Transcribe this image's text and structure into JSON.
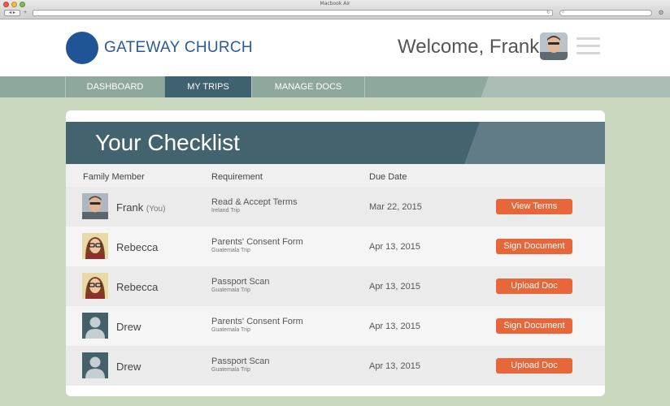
{
  "browser": {
    "window_title": "Macbook Air",
    "nav_label": "◂ ▸",
    "add_label": "+",
    "reload_label": "↻",
    "search_label": "⌕",
    "gear_label": "⚙"
  },
  "header": {
    "logo_text": "GATEWAY CHURCH",
    "welcome": "Welcome, Frank!",
    "logo_color": "#1f5597"
  },
  "nav": {
    "tabs": [
      {
        "label": "DASHBOARD",
        "active": false
      },
      {
        "label": "MY TRIPS",
        "active": true
      },
      {
        "label": "MANAGE DOCS",
        "active": false
      }
    ]
  },
  "checklist": {
    "title": "Your Checklist",
    "columns": [
      "Family Member",
      "Requirement",
      "Due Date"
    ],
    "rows": [
      {
        "member": "Frank",
        "member_note": "(You)",
        "avatar": "frank-photo",
        "requirement": "Read & Accept Terms",
        "trip": "Ireland Trip",
        "due": "Mar 22, 2015",
        "action": "View Terms"
      },
      {
        "member": "Rebecca",
        "member_note": "",
        "avatar": "rebecca-photo",
        "requirement": "Parents' Consent Form",
        "trip": "Guatemala Trip",
        "due": "Apr 13, 2015",
        "action": "Sign Document"
      },
      {
        "member": "Rebecca",
        "member_note": "",
        "avatar": "rebecca-photo",
        "requirement": "Passport Scan",
        "trip": "Guatemala Trip",
        "due": "Apr 13, 2015",
        "action": "Upload Doc"
      },
      {
        "member": "Drew",
        "member_note": "",
        "avatar": "default-user-icon",
        "requirement": "Parents' Consent Form",
        "trip": "Guatemala Trip",
        "due": "Apr 13, 2015",
        "action": "Sign Document"
      },
      {
        "member": "Drew",
        "member_note": "",
        "avatar": "default-user-icon",
        "requirement": "Passport Scan",
        "trip": "Guatemala Trip",
        "due": "Apr 13, 2015",
        "action": "Upload Doc"
      }
    ]
  },
  "colors": {
    "accent_button": "#e8673a",
    "header_band": "#43636f",
    "nav_bar": "#8fa89c",
    "active_tab": "#3f6271"
  }
}
